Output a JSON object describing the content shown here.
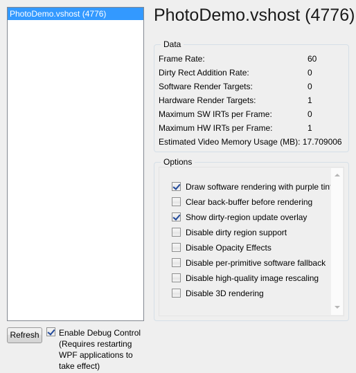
{
  "process_list": {
    "items": [
      {
        "label": "PhotoDemo.vshost (4776)",
        "selected": true
      }
    ]
  },
  "detail": {
    "title": "PhotoDemo.vshost (4776)",
    "data_group": {
      "title": "Data",
      "rows": [
        {
          "label": "Frame Rate:",
          "value": "60"
        },
        {
          "label": "Dirty Rect Addition Rate:",
          "value": "0"
        },
        {
          "label": "Software Render Targets:",
          "value": "0"
        },
        {
          "label": "Hardware Render Targets:",
          "value": "1"
        },
        {
          "label": "Maximum SW IRTs per Frame:",
          "value": "0"
        },
        {
          "label": "Maximum HW IRTs per Frame:",
          "value": "1"
        },
        {
          "label": "Estimated Video Memory Usage (MB):",
          "value": "17.709006",
          "wide": true
        }
      ]
    },
    "options_group": {
      "title": "Options",
      "options": [
        {
          "label": "Draw software rendering with purple tint",
          "checked": true
        },
        {
          "label": "Clear back-buffer before rendering",
          "checked": false
        },
        {
          "label": "Show dirty-region update overlay",
          "checked": true
        },
        {
          "label": "Disable dirty region support",
          "checked": false
        },
        {
          "label": "Disable Opacity Effects",
          "checked": false
        },
        {
          "label": "Disable per-primitive software fallback",
          "checked": false
        },
        {
          "label": "Disable high-quality image rescaling",
          "checked": false
        },
        {
          "label": "Disable 3D rendering",
          "checked": false
        }
      ]
    }
  },
  "footer": {
    "refresh_label": "Refresh",
    "debug_control": {
      "checked": true,
      "label": "Enable Debug Control",
      "note_lines": [
        "(Requires restarting",
        "WPF applications to",
        "take effect)"
      ]
    }
  },
  "colors": {
    "selection": "#3399ff",
    "background": "#efefef",
    "groupbox_border": "#d5dfe7",
    "checkmark": "#21499b"
  }
}
